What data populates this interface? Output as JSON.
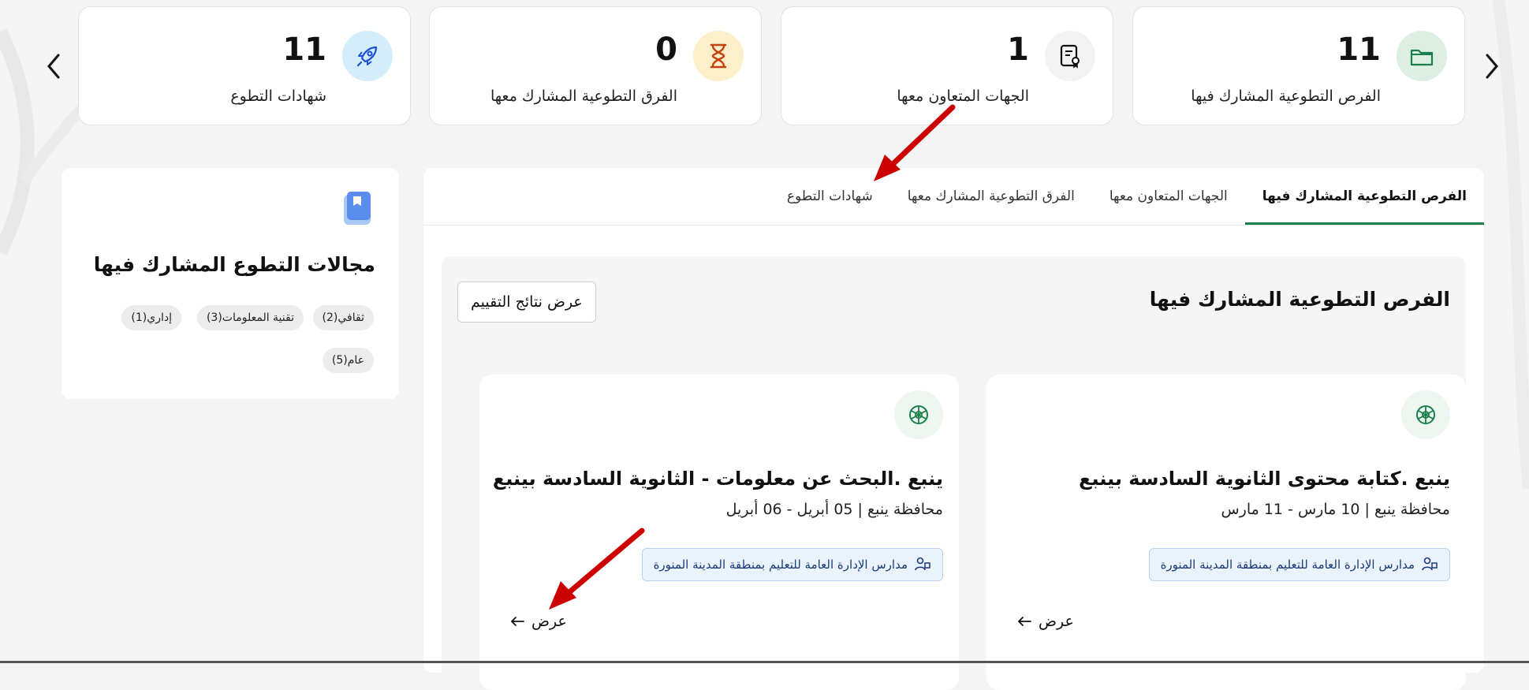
{
  "stats": [
    {
      "value": "11",
      "label": "الفرص التطوعية المشارك فيها",
      "icon": "folder-icon"
    },
    {
      "value": "1",
      "label": "الجهات المتعاون معها",
      "icon": "certificate-icon"
    },
    {
      "value": "0",
      "label": "الفرق التطوعية المشارك معها",
      "icon": "hourglass-icon"
    },
    {
      "value": "11",
      "label": "شهادات التطوع",
      "icon": "rocket-icon"
    }
  ],
  "tabs": [
    {
      "label": "الفرص التطوعية المشارك فيها",
      "active": true
    },
    {
      "label": "الجهات المتعاون معها",
      "active": false
    },
    {
      "label": "الفرق التطوعية المشارك معها",
      "active": false
    },
    {
      "label": "شهادات التطوع",
      "active": false
    }
  ],
  "section": {
    "title": "الفرص التطوعية المشارك فيها",
    "eval_button": "عرض نتائج التقييم"
  },
  "cards": [
    {
      "title": "ينبع .كتابة محتوى الثانوية السادسة بينبع",
      "meta": "محافظة ينبع | 10 مارس - 11 مارس",
      "org": "مدارس الإدارة العامة للتعليم بمنطقة المدينة المنورة",
      "view": "عرض"
    },
    {
      "title": "ينبع .البحث عن معلومات - الثانوية السادسة بينبع",
      "meta": "محافظة ينبع | 05 أبريل - 06 أبريل",
      "org": "مدارس الإدارة العامة للتعليم بمنطقة المدينة المنورة",
      "view": "عرض"
    }
  ],
  "sidebar": {
    "title": "مجالات التطوع المشارك فيها",
    "chips": [
      "ثقافي(2)",
      "تقنية المعلومات(3)",
      "إداري(1)",
      "عام(5)"
    ]
  },
  "colors": {
    "accent": "#1a7f4b",
    "arrow": "#cc0000",
    "org_badge_bg": "#eaf3fc"
  }
}
